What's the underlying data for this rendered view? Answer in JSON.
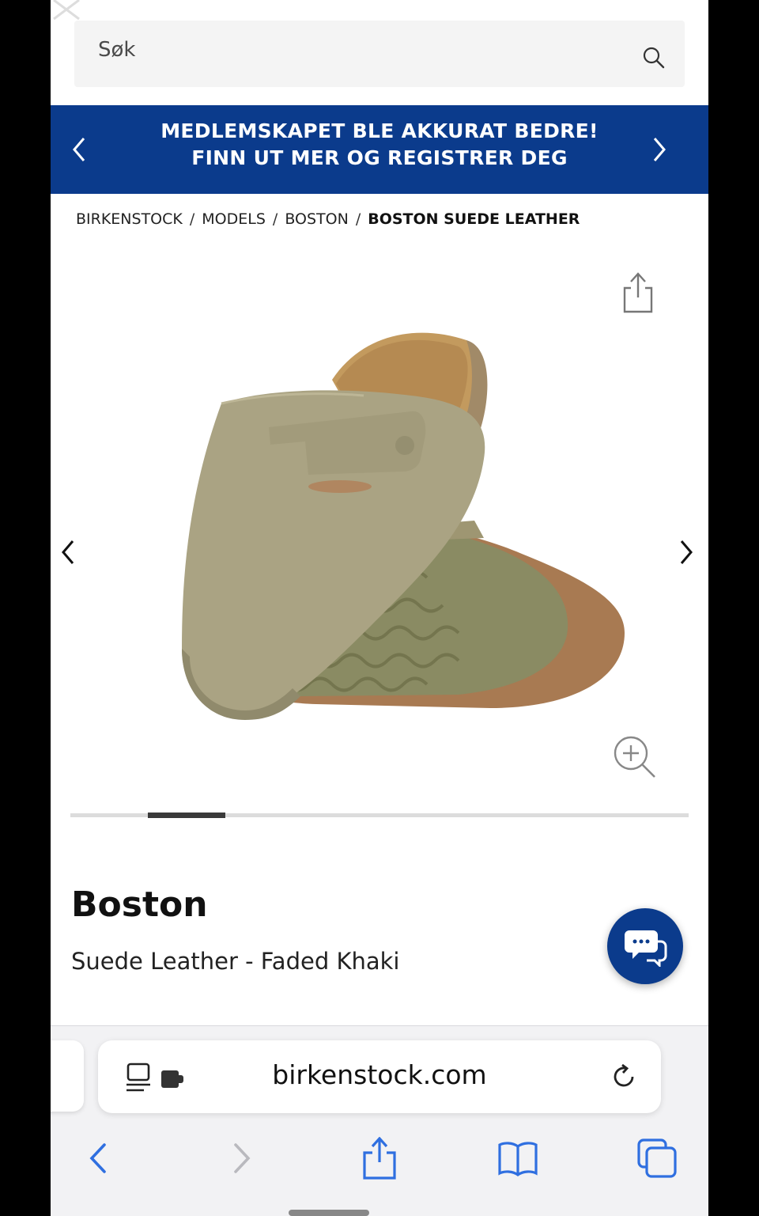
{
  "search": {
    "placeholder": "Søk",
    "icon": "search-icon"
  },
  "promo": {
    "line1": "MEDLEMSKAPET BLE AKKURAT BEDRE!",
    "line2": "FINN UT MER OG REGISTRER DEG",
    "bg_color": "#0b3b8c"
  },
  "breadcrumb": [
    {
      "label": "BIRKENSTOCK"
    },
    {
      "label": "MODELS"
    },
    {
      "label": "BOSTON"
    },
    {
      "label": "BOSTON SUEDE LEATHER"
    }
  ],
  "breadcrumb_separator": "/",
  "gallery": {
    "image_alt": "Boston Suede Leather Faded Khaki clog",
    "progress": {
      "current_index": 1,
      "total": 8
    }
  },
  "product": {
    "name": "Boston",
    "variant": "Suede Leather - Faded Khaki"
  },
  "browser": {
    "url": "birkenstock.com",
    "accent_color": "#2f6fe0"
  }
}
